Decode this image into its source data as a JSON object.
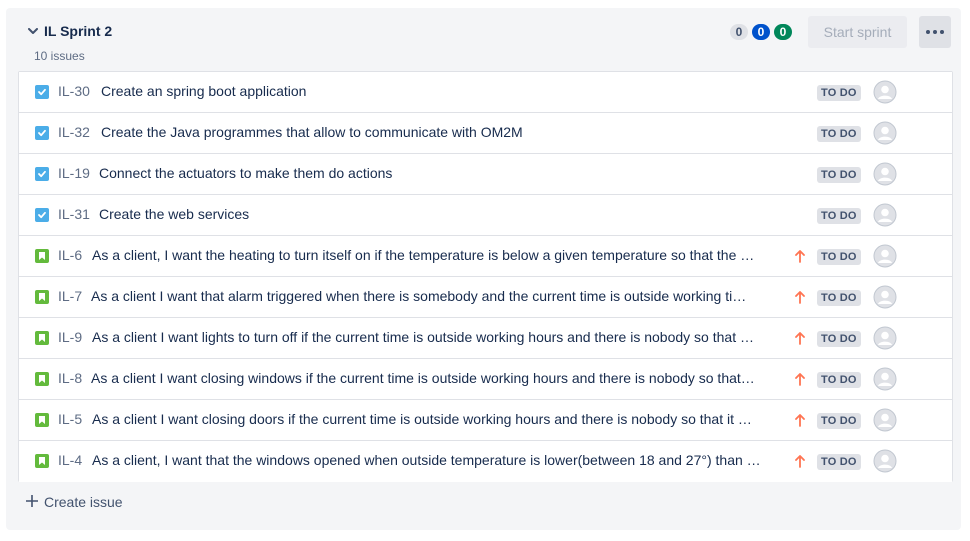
{
  "sprint": {
    "name": "IL Sprint 2",
    "issue_count": "10 issues",
    "counts": {
      "todo": "0",
      "in_progress": "0",
      "done": "0"
    },
    "start_button": "Start sprint",
    "more_icon": "ellipsis-icon",
    "collapse_icon": "chevron-down-icon"
  },
  "colors": {
    "task": "#4bade8",
    "story": "#63ba3c",
    "priority_high": "#ff7452",
    "in_progress": "#0052cc",
    "done": "#00875a"
  },
  "issues": [
    {
      "type": "task",
      "key": "IL-30",
      "summary": "Create an spring boot application",
      "priority": "",
      "status": "TO DO"
    },
    {
      "type": "task",
      "key": "IL-32",
      "summary": "Create the Java programmes that allow to communicate with OM2M",
      "priority": "",
      "status": "TO DO"
    },
    {
      "type": "task",
      "key": "IL-19",
      "summary": "Connect the actuators to make them do actions",
      "priority": "",
      "status": "TO DO"
    },
    {
      "type": "task",
      "key": "IL-31",
      "summary": "Create the web services",
      "priority": "",
      "status": "TO DO"
    },
    {
      "type": "story",
      "key": "IL-6",
      "summary": "As a client, I want the heating to turn itself on if the temperature is below a given temperature so that the …",
      "priority": "high",
      "status": "TO DO"
    },
    {
      "type": "story",
      "key": "IL-7",
      "summary": "As a client I want that alarm triggered when there is somebody and the current time is outside working ti…",
      "priority": "high",
      "status": "TO DO"
    },
    {
      "type": "story",
      "key": "IL-9",
      "summary": "As a client I want lights to turn off if the current time is outside working hours and there is nobody so that …",
      "priority": "high",
      "status": "TO DO"
    },
    {
      "type": "story",
      "key": "IL-8",
      "summary": "As a client I want closing windows if the current time is outside working hours and there is nobody so that…",
      "priority": "high",
      "status": "TO DO"
    },
    {
      "type": "story",
      "key": "IL-5",
      "summary": "As a client I want closing doors if the current time is outside working hours and there is nobody so that it …",
      "priority": "high",
      "status": "TO DO"
    },
    {
      "type": "story",
      "key": "IL-4",
      "summary": "As a client, I want that the windows opened when outside temperature is lower(between 18 and 27°) than …",
      "priority": "high",
      "status": "TO DO"
    }
  ],
  "create_issue": "Create issue"
}
